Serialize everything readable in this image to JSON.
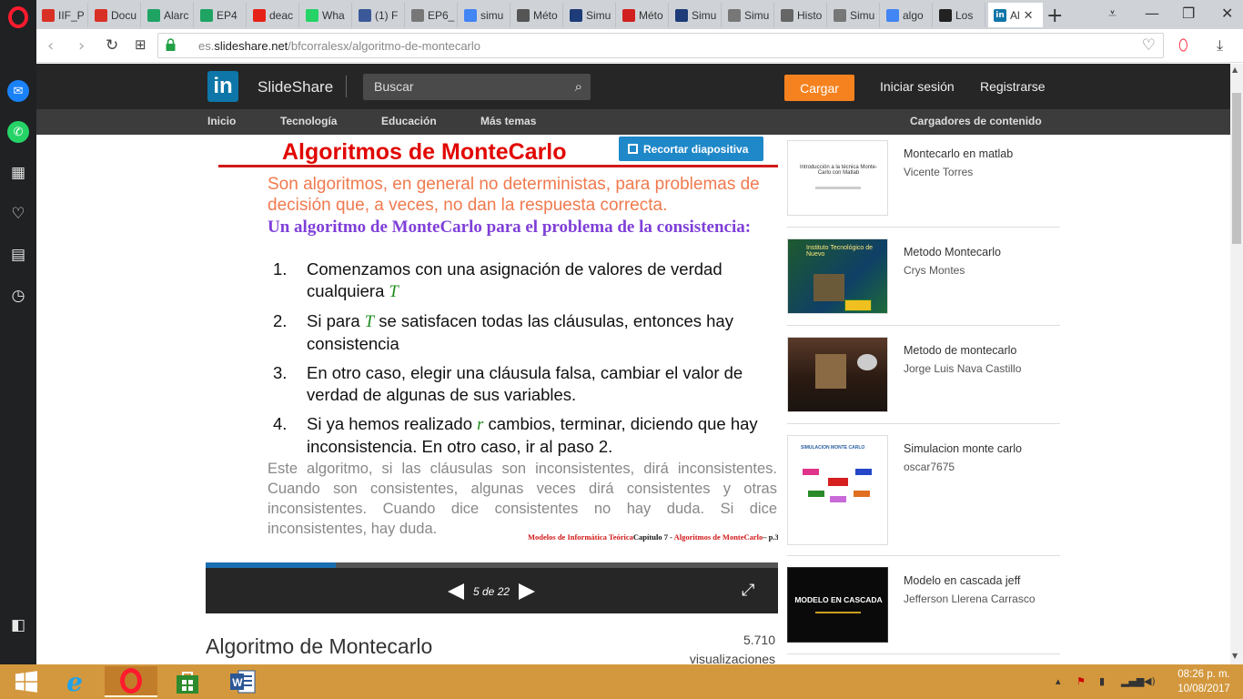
{
  "browser": {
    "tabs": [
      {
        "label": "IIF_P",
        "icon": "gmail-icon",
        "color": "#d93025"
      },
      {
        "label": "Docu",
        "icon": "gmail-icon",
        "color": "#d93025"
      },
      {
        "label": "Alarc",
        "icon": "drive-icon",
        "color": "#1fa463"
      },
      {
        "label": "EP4",
        "icon": "drive-icon",
        "color": "#1fa463"
      },
      {
        "label": "deac",
        "icon": "youtube-icon",
        "color": "#e62117"
      },
      {
        "label": "Wha",
        "icon": "whatsapp-icon",
        "color": "#25d366"
      },
      {
        "label": "(1) F",
        "icon": "facebook-icon",
        "color": "#3b5998"
      },
      {
        "label": "EP6_",
        "icon": "document-icon",
        "color": "#777777"
      },
      {
        "label": "simu",
        "icon": "google-icon",
        "color": "#4285f4"
      },
      {
        "label": "Méto",
        "icon": "wikipedia-icon",
        "color": "#555555"
      },
      {
        "label": "Simu",
        "icon": "academia-icon",
        "color": "#1d3c78"
      },
      {
        "label": "Méto",
        "icon": "opera-page-icon",
        "color": "#d11f1f"
      },
      {
        "label": "Simu",
        "icon": "academia-icon",
        "color": "#1d3c78"
      },
      {
        "label": "Simu",
        "icon": "document-icon",
        "color": "#777777"
      },
      {
        "label": "Histo",
        "icon": "history-icon",
        "color": "#666666"
      },
      {
        "label": "Simu",
        "icon": "document-icon",
        "color": "#777777"
      },
      {
        "label": "algo",
        "icon": "google-icon",
        "color": "#4285f4"
      },
      {
        "label": "Los",
        "icon": "bunny-icon",
        "color": "#222222"
      }
    ],
    "active_tab": {
      "label": "Al",
      "icon": "linkedin-icon",
      "color": "#0e76a8"
    },
    "url_gray_prefix": "es.",
    "url_domain": "slideshare.net",
    "url_path": "/bfcorralesx/algoritmo-de-montecarlo"
  },
  "site": {
    "logo_text": "in",
    "brand": "SlideShare",
    "search_placeholder": "Buscar",
    "upload_label": "Cargar",
    "login_label": "Iniciar sesión",
    "register_label": "Registrarse",
    "nav": [
      "Inicio",
      "Tecnología",
      "Educación",
      "Más temas"
    ],
    "uploaders_label": "Cargadores de contenido"
  },
  "slide": {
    "title": "Algoritmos de MonteCarlo",
    "clip_label": "Recortar diapositiva",
    "intro": "Son algoritmos, en general no deterministas, para problemas de decisión que, a veces, no dan la respuesta correcta.",
    "subtitle": "Un algoritmo de MonteCarlo para el problema de la consistencia:",
    "steps": [
      {
        "num": "1.",
        "pre": "Comenzamos con una asignación de valores de verdad cualquiera ",
        "var": "T",
        "post": ""
      },
      {
        "num": "2.",
        "pre": "Si para ",
        "var": "T",
        "post": " se satisfacen todas las cláusulas, entonces hay consistencia"
      },
      {
        "num": "3.",
        "pre": "En otro caso, elegir una cláusula falsa, cambiar el valor de verdad de algunas de sus variables.",
        "var": "",
        "post": ""
      },
      {
        "num": "4.",
        "pre": "Si ya hemos realizado ",
        "var": "r",
        "post": " cambios, terminar, diciendo que hay inconsistencia. En otro caso, ir al paso 2."
      }
    ],
    "note": "Este algoritmo, si las cláusulas son inconsistentes, dirá inconsistentes. Cuando son consistentes, algunas veces dirá consistentes y otras inconsistentes. Cuando dice consistentes no hay duda. Si dice inconsistentes, hay duda.",
    "footer_red1": "Modelos de Informática Teórica",
    "footer_black1": "Capítulo 7 - ",
    "footer_red2": "Algoritmos de MonteCarlo",
    "footer_black2": "– p.3/20"
  },
  "player": {
    "pager": "5 de 22",
    "progress_fraction": 0.227
  },
  "document": {
    "title": "Algoritmo de Montecarlo",
    "views_count": "5.710",
    "views_label": "visualizaciones"
  },
  "related": [
    {
      "title": "Montecarlo en matlab",
      "author": "Vicente Torres",
      "thumb_text": "Introducción a la técnica Monte-Carlo con Matlab"
    },
    {
      "title": "Metodo Montecarlo",
      "author": "Crys Montes",
      "thumb_text": "Instituto Tecnológico de Nuevo"
    },
    {
      "title": "Metodo de montecarlo",
      "author": "Jorge Luis Nava Castillo",
      "thumb_text": ""
    },
    {
      "title": "Simulacion monte carlo",
      "author": "oscar7675",
      "thumb_text": "SIMULACION MONTE CARLO"
    },
    {
      "title": "Modelo en cascada jeff",
      "author": "Jefferson Llerena Carrasco",
      "thumb_text": "MODELO EN CASCADA"
    }
  ],
  "taskbar": {
    "time": "08:26 p. m.",
    "date": "10/08/2017"
  }
}
